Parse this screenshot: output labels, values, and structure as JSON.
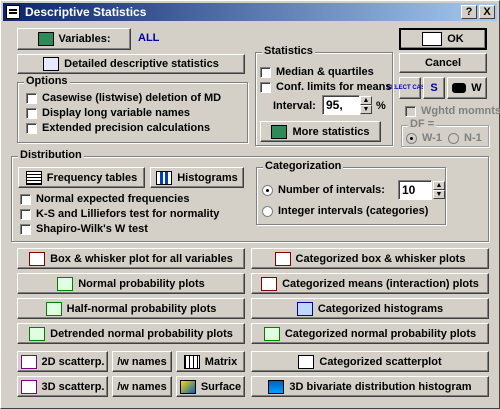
{
  "window": {
    "title": "Descriptive Statistics",
    "help_label": "?",
    "close_label": "X"
  },
  "variables": {
    "button_label": "Variables:",
    "value": "ALL"
  },
  "buttons": {
    "detailed": "Detailed descriptive statistics",
    "ok": "OK",
    "cancel": "Cancel",
    "select_cases": "SELECT CASES",
    "s_label": "S",
    "w_label": "W",
    "more_stats": "More statistics",
    "freq_tables": "Frequency tables",
    "histograms": "Histograms"
  },
  "options": {
    "label": "Options",
    "items": [
      "Casewise (listwise) deletion of MD",
      "Display long variable names",
      "Extended precision calculations"
    ]
  },
  "statistics": {
    "label": "Statistics",
    "median": "Median & quartiles",
    "conf": "Conf. limits for means",
    "interval_label": "Interval:",
    "interval_value": "95,",
    "percent": "%"
  },
  "weights": {
    "label": "Wghtd momnts",
    "df_label": "DF =",
    "w1": "W-1",
    "n1": "N-1"
  },
  "distribution": {
    "label": "Distribution",
    "items": [
      "Normal expected frequencies",
      "K-S and Lilliefors test for normality",
      "Shapiro-Wilk's W test"
    ]
  },
  "categorization": {
    "label": "Categorization",
    "num_intervals": "Number of intervals:",
    "num_value": "10",
    "integer_intervals": "Integer intervals (categories)"
  },
  "plots_left": [
    "Box & whisker plot for all variables",
    "Normal probability plots",
    "Half-normal probability plots",
    "Detrended normal probability plots"
  ],
  "plots_right": [
    "Categorized box & whisker plots",
    "Categorized means (interaction) plots",
    "Categorized histograms",
    "Categorized normal probability plots"
  ],
  "bottom": {
    "scatter2d": "2D scatterp.",
    "scatter3d": "3D scatterp.",
    "wnames": "/w names",
    "matrix": "Matrix",
    "surface": "Surface",
    "cat_scatter": "Categorized scatterplot",
    "bivar": "3D bivariate distribution histogram"
  }
}
